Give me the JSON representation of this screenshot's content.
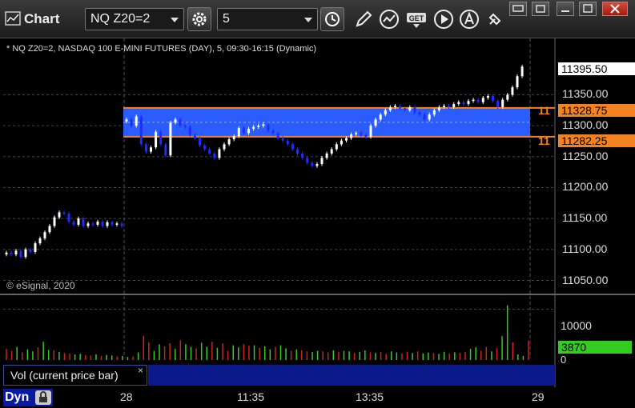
{
  "app": {
    "title": "Chart"
  },
  "toolbar": {
    "symbol": "NQ Z20=2",
    "interval": "5"
  },
  "chart": {
    "status_line": "* NQ Z20=2, NASDAQ 100 E-MINI FUTURES (DAY), 5, 09:30-16:15 (Dynamic)",
    "copyright": "© eSignal, 2020",
    "y_ticks": [
      "11350.00",
      "11300.00",
      "11250.00",
      "11200.00",
      "11150.00",
      "11100.00",
      "11050.00"
    ],
    "y_tick_values": [
      11350,
      11300,
      11250,
      11200,
      11150,
      11100,
      11050
    ],
    "last_price": "11395.50",
    "band_top_price": "11328.75",
    "band_bottom_price": "11282.25",
    "band_top_truncated": "11",
    "band_bottom_truncated": "11",
    "x_ticks": [
      "28",
      "11:35",
      "13:35",
      "29"
    ],
    "colors": {
      "up": "#ffffff",
      "down": "#1e2cff",
      "band_fill": "#2a5cff",
      "band_line": "#f58220",
      "vol_up": "#33cc22",
      "vol_down": "#d02020"
    }
  },
  "volume": {
    "label": "Vol (current price bar)",
    "close_glyph": "×",
    "y_ticks": [
      "10000",
      "0"
    ],
    "current_value": "3870"
  },
  "footer": {
    "dyn_label": "Dyn"
  },
  "chart_data": {
    "type": "candlestick",
    "title": "",
    "ylim": [
      11030,
      11410
    ],
    "band": {
      "top": 11328.75,
      "bottom": 11282.25
    },
    "last": 11395.5,
    "closes_day1": [
      11095,
      11092,
      11098,
      11088,
      11100,
      11096,
      11110,
      11118,
      11128,
      11138,
      11152,
      11160,
      11158,
      11145,
      11140,
      11150,
      11138,
      11142,
      11140,
      11145,
      11138,
      11144,
      11140,
      11142,
      11138
    ],
    "closes_day2": [
      11310,
      11300,
      11315,
      11270,
      11258,
      11265,
      11290,
      11270,
      11252,
      11305,
      11310,
      11300,
      11298,
      11285,
      11280,
      11268,
      11262,
      11255,
      11248,
      11262,
      11270,
      11278,
      11283,
      11296,
      11288,
      11295,
      11298,
      11300,
      11302,
      11292,
      11288,
      11280,
      11276,
      11270,
      11262,
      11255,
      11248,
      11240,
      11235,
      11238,
      11248,
      11255,
      11262,
      11270,
      11276,
      11280,
      11286,
      11288,
      11285,
      11282,
      11300,
      11310,
      11318,
      11325,
      11330,
      11332,
      11328,
      11325,
      11330,
      11322,
      11318,
      11310,
      11318,
      11325,
      11330,
      11332,
      11330,
      11335,
      11338,
      11335,
      11340,
      11342,
      11338,
      11345,
      11348,
      11340,
      11330,
      11342,
      11350,
      11362,
      11380,
      11395.5
    ],
    "volumes": [
      2200,
      1800,
      2600,
      1500,
      2100,
      1700,
      2500,
      3600,
      2000,
      1900,
      1600,
      1400,
      1300,
      1100,
      1200,
      1000,
      900,
      1100,
      800,
      1000,
      900,
      700,
      800,
      600,
      700,
      1500,
      4800,
      3500,
      1800,
      3100,
      2700,
      3300,
      2200,
      3900,
      3100,
      2600,
      2300,
      3400,
      2600,
      3600,
      2400,
      3300,
      1800,
      2900,
      2500,
      3100,
      2800,
      2900,
      2400,
      2700,
      2100,
      2600,
      2900,
      2300,
      1800,
      2100,
      1900,
      1700,
      1600,
      1800,
      1700,
      1500,
      1900,
      1600,
      1800,
      1700,
      1400,
      1600,
      1900,
      1500,
      1400,
      1600,
      1200,
      1700,
      1500,
      1300,
      1600,
      1400,
      1700,
      1300,
      1500,
      1400,
      1200,
      1600,
      1300,
      1500,
      1400,
      1600,
      2200,
      2500,
      1800,
      2600,
      1700,
      2400,
      4700,
      10800,
      3500,
      1100,
      800,
      3870
    ],
    "ylim_volume": [
      0,
      12000
    ]
  }
}
